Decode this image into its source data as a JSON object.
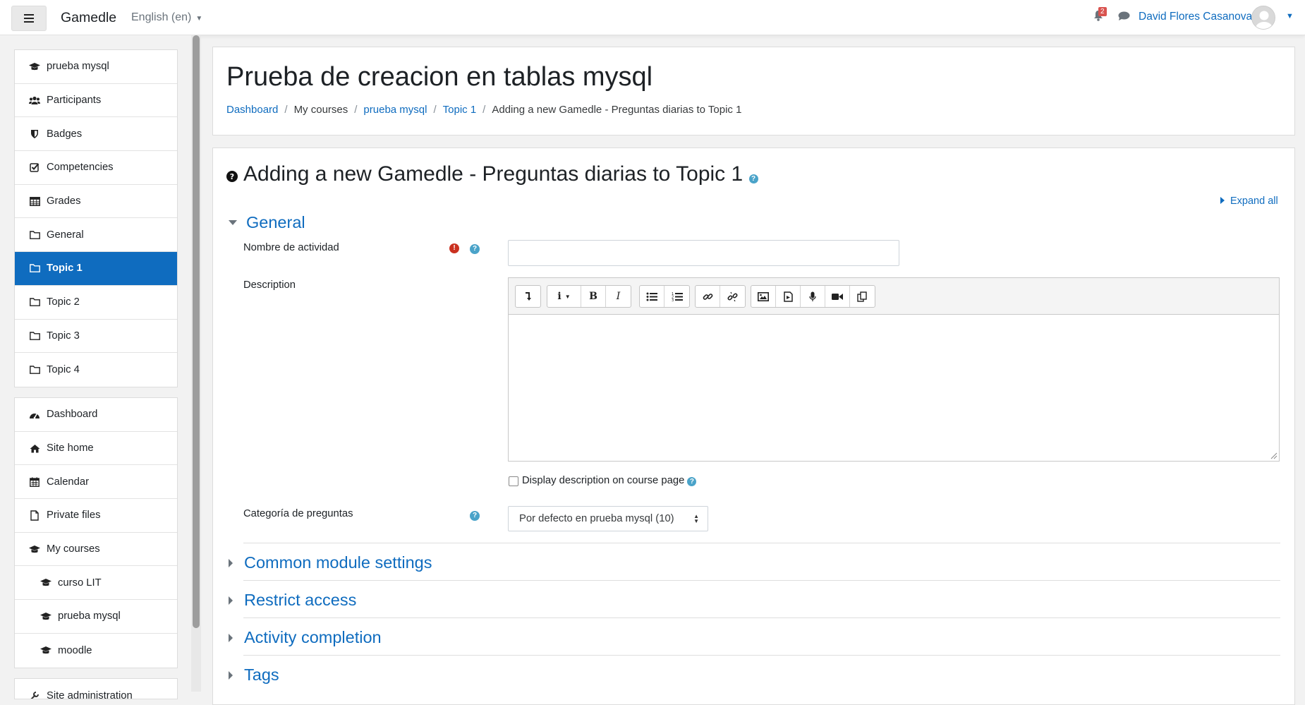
{
  "navbar": {
    "brand": "Gamedle",
    "language": "English (en)",
    "notifications_count": "2",
    "username": "David Flores Casanova"
  },
  "sidebar": {
    "course_items": [
      {
        "label": "prueba mysql",
        "icon": "graduation-cap-icon"
      },
      {
        "label": "Participants",
        "icon": "users-icon"
      },
      {
        "label": "Badges",
        "icon": "shield-icon"
      },
      {
        "label": "Competencies",
        "icon": "check-square-icon"
      },
      {
        "label": "Grades",
        "icon": "table-icon"
      },
      {
        "label": "General",
        "icon": "folder-icon"
      },
      {
        "label": "Topic 1",
        "icon": "folder-icon",
        "active": true
      },
      {
        "label": "Topic 2",
        "icon": "folder-icon"
      },
      {
        "label": "Topic 3",
        "icon": "folder-icon"
      },
      {
        "label": "Topic 4",
        "icon": "folder-icon"
      }
    ],
    "site_items": [
      {
        "label": "Dashboard",
        "icon": "tachometer-icon"
      },
      {
        "label": "Site home",
        "icon": "home-icon"
      },
      {
        "label": "Calendar",
        "icon": "calendar-icon"
      },
      {
        "label": "Private files",
        "icon": "file-icon"
      },
      {
        "label": "My courses",
        "icon": "graduation-cap-icon"
      },
      {
        "label": "curso LIT",
        "icon": "graduation-cap-icon",
        "indent": true
      },
      {
        "label": "prueba mysql",
        "icon": "graduation-cap-icon",
        "indent": true
      },
      {
        "label": "moodle",
        "icon": "graduation-cap-icon",
        "indent": true
      }
    ],
    "partial_item": "Site administration"
  },
  "header": {
    "title": "Prueba de creacion en tablas mysql",
    "breadcrumb": [
      "Dashboard",
      "My courses",
      "prueba mysql",
      "Topic 1",
      "Adding a new Gamedle - Preguntas diarias to Topic 1"
    ]
  },
  "form": {
    "heading": "Adding a new Gamedle - Preguntas diarias to Topic 1",
    "expand_all": "Expand all",
    "general_section": "General",
    "activity_name_label": "Nombre de actividad",
    "activity_name_value": "",
    "description_label": "Description",
    "display_description_label": "Display description on course page",
    "category_label": "Categoría de preguntas",
    "category_selected": "Por defecto en prueba mysql (10)",
    "collapsed_sections": [
      "Common module settings",
      "Restrict access",
      "Activity completion",
      "Tags"
    ]
  },
  "colors": {
    "accent": "#0f6cbf",
    "required": "#ca3120",
    "help": "#4aa3c9",
    "badge": "#d9534f"
  }
}
